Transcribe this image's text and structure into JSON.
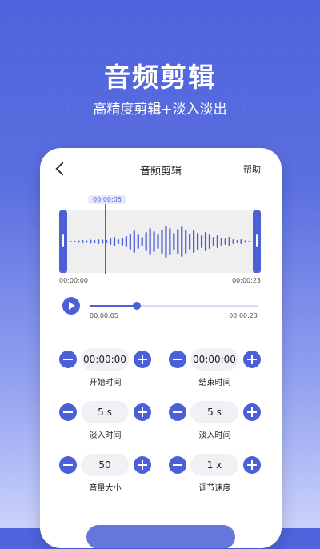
{
  "hero": {
    "title": "音频剪辑",
    "subtitle": "高精度剪辑+淡入淡出"
  },
  "nav": {
    "title": "音频剪辑",
    "help": "帮助"
  },
  "waveform": {
    "cursor_time": "00:00:05",
    "start_time": "00:00:00",
    "end_time": "00:00:23",
    "accent": "#4b5fd6",
    "bars": [
      2,
      2,
      3,
      4,
      3,
      5,
      4,
      6,
      5,
      4,
      8,
      12,
      6,
      10,
      14,
      20,
      28,
      18,
      12,
      24,
      34,
      26,
      18,
      30,
      40,
      34,
      22,
      32,
      38,
      30,
      20,
      28,
      22,
      16,
      24,
      18,
      12,
      16,
      10,
      8,
      12,
      6,
      4,
      6,
      3,
      2
    ]
  },
  "player": {
    "current": "00:00:05",
    "total": "00:00:23",
    "progress": 0.28
  },
  "controls": [
    {
      "value": "00:00:00",
      "label": "开始时间"
    },
    {
      "value": "00:00:00",
      "label": "结束时间"
    },
    {
      "value": "5 s",
      "label": "淡入时间"
    },
    {
      "value": "5 s",
      "label": "淡入时间"
    },
    {
      "value": "50",
      "label": "音量大小"
    },
    {
      "value": "1 x",
      "label": "调节速度"
    }
  ]
}
